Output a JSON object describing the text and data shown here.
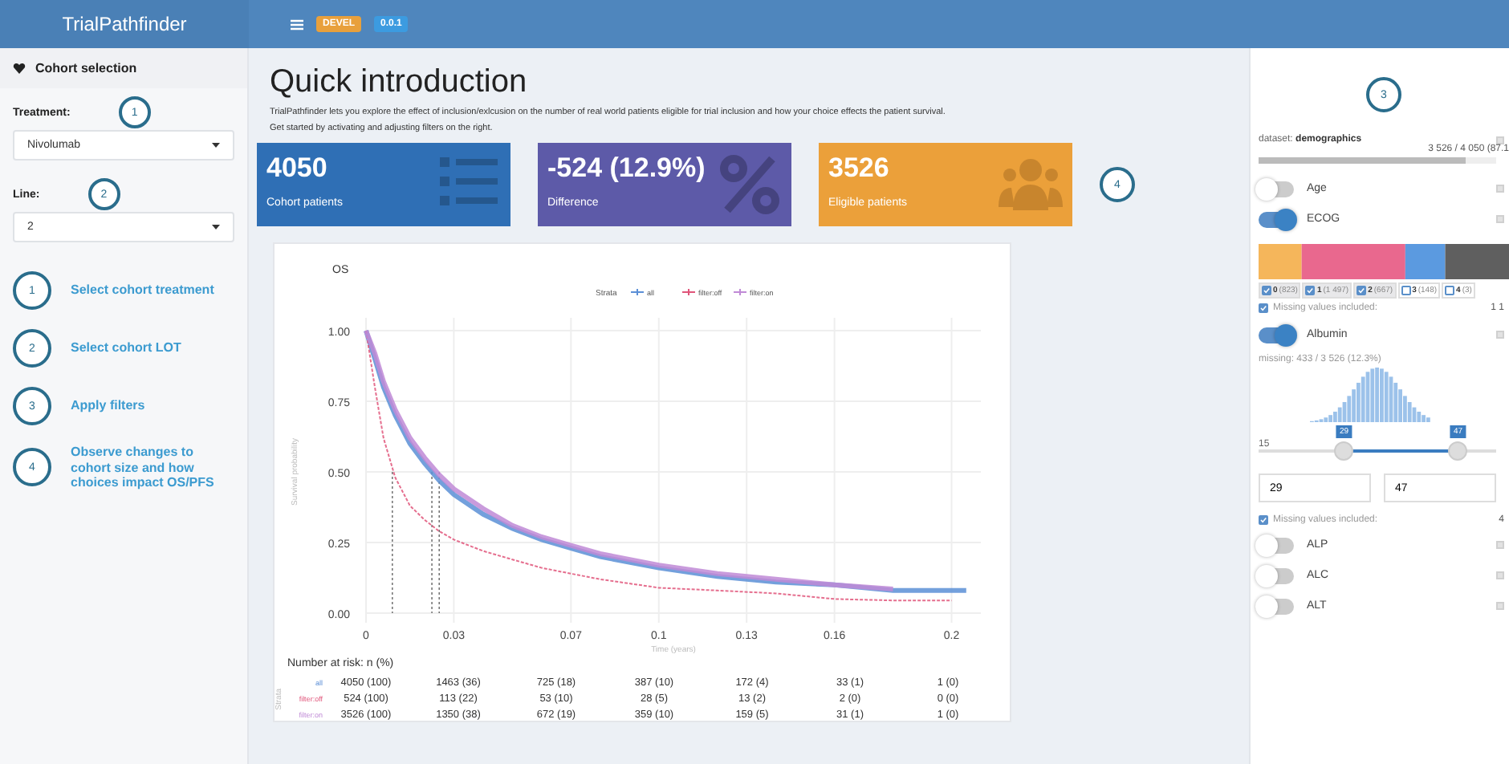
{
  "header": {
    "title": "TrialPathfinder",
    "badges": [
      {
        "label": "DEVEL",
        "color": "#e8a03c"
      },
      {
        "label": "0.0.1",
        "color": "#3c9be0"
      }
    ]
  },
  "sidebar": {
    "section": "Cohort selection",
    "fields": [
      {
        "label": "Treatment:",
        "step": "1",
        "value": "Nivolumab"
      },
      {
        "label": "Line:",
        "step": "2",
        "value": "2"
      }
    ],
    "steps": [
      {
        "number": "1",
        "text": "Select cohort treatment"
      },
      {
        "number": "2",
        "text": "Select cohort LOT"
      },
      {
        "number": "3",
        "text": "Apply filters"
      },
      {
        "number": "4",
        "text": "Observe changes to cohort size and how choices impact OS/PFS"
      }
    ]
  },
  "main": {
    "title": "Quick introduction",
    "paragraphs": [
      "TrialPathfinder lets you explore the effect of inclusion/exlcusion on the number of real world patients eligible for trial inclusion and how your choice effects the patient survival.",
      "Get started by activating and adjusting filters on the right."
    ],
    "cards": [
      {
        "kind": "list",
        "value": "4050",
        "label": "Cohort patients",
        "color": "#2f6fb5"
      },
      {
        "kind": "percent",
        "value": "-524 (12.9%)",
        "label": "Difference",
        "color": "#5d5aa8"
      },
      {
        "kind": "people",
        "value": "3526",
        "label": "Eligible patients",
        "color": "#eba03a"
      }
    ],
    "cards_step": "4",
    "chart": {
      "title": "OS",
      "legend_title": "Strata",
      "chart_data": {
        "type": "line",
        "xlabel": "Time (years)",
        "ylabel": "Survival probability",
        "grid": true,
        "legend": true,
        "x": [
          0,
          0.003,
          0.006,
          0.01,
          0.015,
          0.02,
          0.025,
          0.03,
          0.04,
          0.05,
          0.06,
          0.07,
          0.08,
          0.1,
          0.12,
          0.14,
          0.16,
          0.18,
          0.2,
          0.205
        ],
        "series": [
          {
            "name": "all",
            "color": "#5b8fd6",
            "line_style": "solid",
            "values": [
              1,
              0.9,
              0.8,
              0.7,
              0.6,
              0.53,
              0.47,
              0.42,
              0.35,
              0.3,
              0.26,
              0.23,
              0.2,
              0.16,
              0.13,
              0.11,
              0.1,
              0.08,
              0.08,
              0.08
            ]
          },
          {
            "name": "filter:off",
            "color": "#e0557a",
            "line_style": "dashed",
            "values": [
              1,
              0.8,
              0.62,
              0.48,
              0.38,
              0.33,
              0.29,
              0.26,
              0.22,
              0.19,
              0.16,
              0.14,
              0.12,
              0.09,
              0.08,
              0.07,
              0.05,
              0.045,
              0.045,
              null
            ]
          },
          {
            "name": "filter:on",
            "color": "#c08ad6",
            "line_style": "solid",
            "values": [
              1,
              0.92,
              0.82,
              0.72,
              0.62,
              0.55,
              0.49,
              0.44,
              0.37,
              0.31,
              0.27,
              0.24,
              0.21,
              0.17,
              0.14,
              0.12,
              0.1,
              0.085,
              null,
              null
            ]
          }
        ],
        "ref_lines": [
          {
            "axis": "x",
            "value": 0.009
          },
          {
            "axis": "x",
            "value": 0.0225
          },
          {
            "axis": "x",
            "value": 0.025
          }
        ],
        "xlim": [
          0,
          0.21
        ],
        "ylim": [
          0,
          1
        ],
        "xticks": [
          0,
          0.03,
          0.07,
          0.1,
          0.13,
          0.16,
          0.2
        ],
        "yticks": [
          {
            "value": 0,
            "label": "0.00"
          },
          {
            "value": 0.25,
            "label": "0.25"
          },
          {
            "value": 0.5,
            "label": "0.50"
          },
          {
            "value": 0.75,
            "label": "0.75"
          },
          {
            "value": 1,
            "label": "1.00"
          }
        ]
      },
      "risk_table": {
        "title": "Number at risk: n (%)",
        "axis_label": "Strata",
        "rows": [
          {
            "name": "all",
            "cells": [
              "4050 (100)",
              "1463 (36)",
              "725 (18)",
              "387 (10)",
              "172 (4)",
              "33 (1)",
              "1 (0)"
            ]
          },
          {
            "name": "filter:off",
            "cells": [
              "524 (100)",
              "113 (22)",
              "53 (10)",
              "28 (5)",
              "13 (2)",
              "2 (0)",
              "0 (0)"
            ]
          },
          {
            "name": "filter:on",
            "cells": [
              "3526 (100)",
              "1350 (38)",
              "672 (19)",
              "359 (10)",
              "159 (5)",
              "31 (1)",
              "1 (0)"
            ]
          }
        ]
      }
    }
  },
  "filter_panel": {
    "step": "3",
    "dataset_label": "dataset:",
    "dataset_name": "demographics",
    "count_text": "3 526 / 4 050 (87.1",
    "level": 0.87,
    "filters": [
      {
        "kind": "toggle",
        "name": "Age",
        "on": false
      },
      {
        "kind": "categorical",
        "name": "ECOG",
        "on": true,
        "categories": [
          {
            "value": "0",
            "count": "(823)",
            "checked": true
          },
          {
            "value": "1",
            "count": "(1 497)",
            "checked": true
          },
          {
            "value": "2",
            "count": "(667)",
            "checked": true
          },
          {
            "value": "3",
            "count": "(148)",
            "checked": false
          },
          {
            "value": "4",
            "count": "(3)",
            "checked": false
          }
        ],
        "missing": {
          "label": "Missing values included:",
          "checked": true,
          "count": "1 1"
        }
      },
      {
        "kind": "range",
        "name": "Albumin",
        "on": true,
        "missing_text": "missing: 433 / 3 526 (12.3%)",
        "min_label": "15",
        "low": {
          "label": "29",
          "level": 0.36
        },
        "high": {
          "label": "47",
          "level": 0.84
        },
        "inputs": [
          "29",
          "47"
        ],
        "missing": {
          "label": "Missing values included:",
          "checked": true,
          "count": "4"
        }
      },
      {
        "kind": "toggle",
        "name": "ALP",
        "on": false
      },
      {
        "kind": "toggle",
        "name": "ALC",
        "on": false
      },
      {
        "kind": "toggle",
        "name": "ALT",
        "on": false
      }
    ]
  }
}
